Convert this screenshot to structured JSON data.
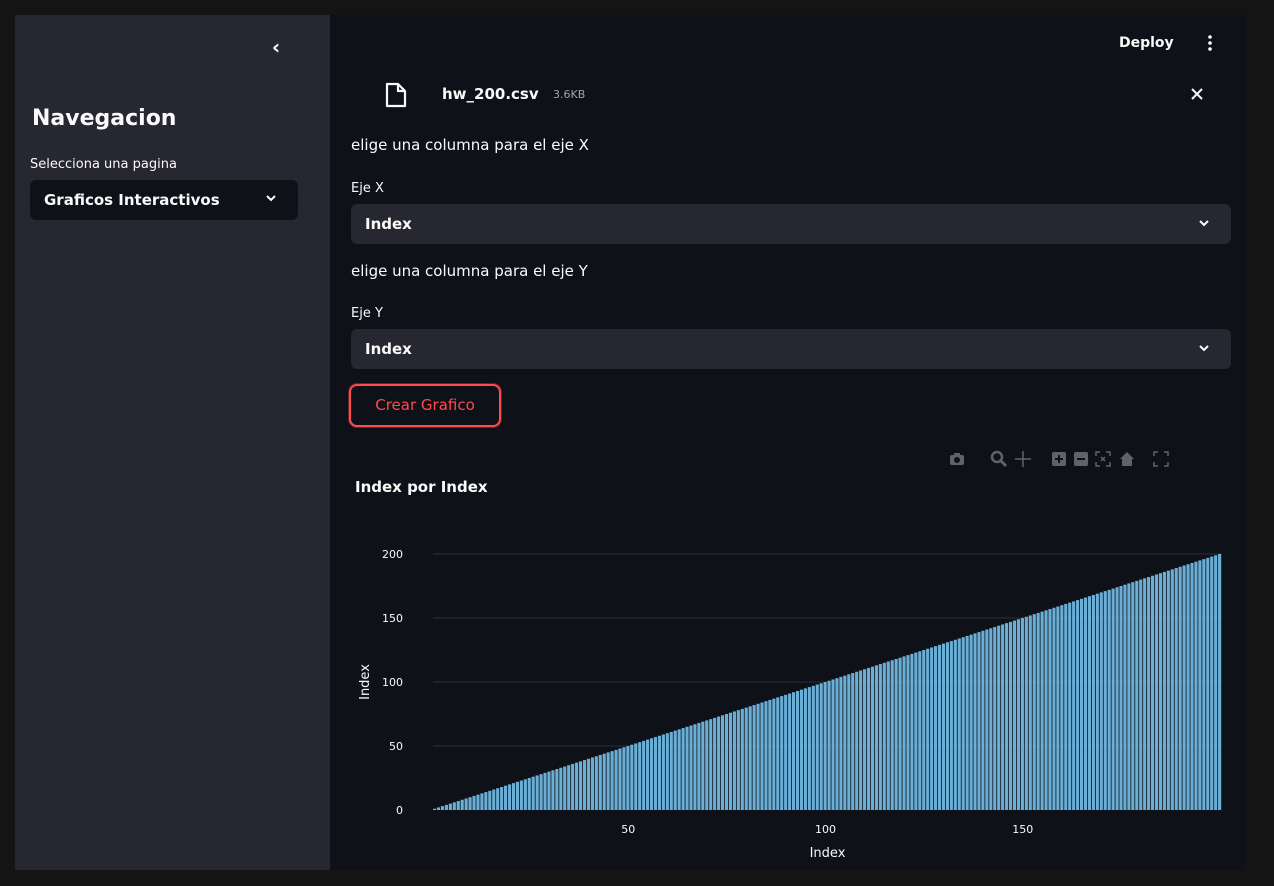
{
  "sidebar": {
    "collapse_icon": "chevron-left-icon",
    "title": "Navegacion",
    "select_label": "Selecciona una pagina",
    "select_value": "Graficos Interactivos"
  },
  "header": {
    "deploy_label": "Deploy",
    "menu_icon": "kebab-menu-icon"
  },
  "file": {
    "name": "hw_200.csv",
    "size": "3.6KB",
    "icon": "file-icon",
    "close_icon": "close-icon"
  },
  "x_section": {
    "prompt": "elige una columna para el eje X",
    "label": "Eje X",
    "value": "Index"
  },
  "y_section": {
    "prompt": "elige una columna para el eje Y",
    "label": "Eje Y",
    "value": "Index"
  },
  "button": {
    "label": "Crear Grafico",
    "color": "#ff4b4b"
  },
  "modebar": [
    "camera-icon",
    "zoom-icon",
    "pan-icon",
    "zoom-in-icon",
    "zoom-out-icon",
    "autoscale-icon",
    "home-icon",
    "fullscreen-icon"
  ],
  "chart_data": {
    "type": "bar",
    "title": "Index por Index",
    "xlabel": "Index",
    "ylabel": "Index",
    "x": {
      "start": 1,
      "end": 200,
      "step": 1
    },
    "y_equals_x": true,
    "xlim": [
      0.5,
      200.5
    ],
    "ylim": [
      0,
      200
    ],
    "xticks": [
      50,
      100,
      150
    ],
    "yticks": [
      0,
      50,
      100,
      150,
      200
    ],
    "bar_color": "#6baed6",
    "grid": true
  }
}
